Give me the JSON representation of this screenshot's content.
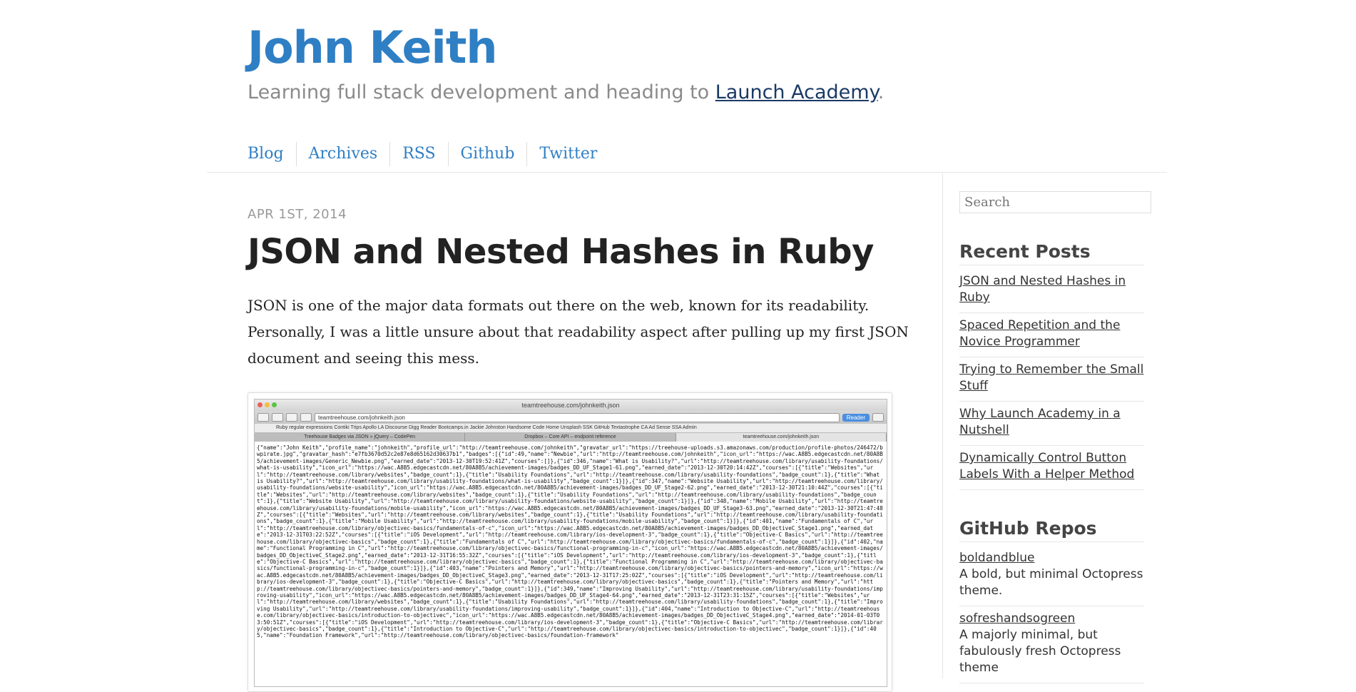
{
  "header": {
    "title": "John Keith",
    "tagline_prefix": "Learning full stack development and heading to ",
    "tagline_link": "Launch Academy",
    "tagline_suffix": "."
  },
  "nav": {
    "items": [
      "Blog",
      "Archives",
      "RSS",
      "Github",
      "Twitter"
    ]
  },
  "post": {
    "date": "APR 1ST, 2014",
    "title": "JSON and Nested Hashes in Ruby",
    "body": "JSON is one of the major data formats out there on the web, known for its readability. Personally, I was a little unsure about that readability aspect after pulling up my first JSON document and seeing this mess."
  },
  "screenshot": {
    "window_title": "teamtreehouse.com/johnkeith.json",
    "url": "teamtreehouse.com/johnkeith.json",
    "reader_label": "Reader",
    "bookmarks": "Ruby regular expressions   Contiki Trips   Apollo   LA Discourse   Digg Reader   Bootcamps.in   Jackie Johnston   Handsome Code   Home   Unsplash   SSK   GitHub   Textastrophe   CA   Ad Sense   SSA Admin",
    "tabs": [
      "Treehouse Badges via JSON » jQuery – CodePen",
      "Dropbox – Core API – endpoint reference",
      "teamtreehouse.com/johnkeith.json"
    ],
    "json_text": "{\"name\":\"John Keith\",\"profile_name\":\"johnkeith\",\"profile_url\":\"http://teamtreehouse.com/johnkeith\",\"gravatar_url\":\"https://treehouse-uploads.s3.amazonaws.com/production/profile-photos/246472/bwpirate.jpg\",\"gravatar_hash\":\"e7fb3670d52c2e87e8d65162d30637b1\",\"badges\":[{\"id\":49,\"name\":\"Newbie\",\"url\":\"http://teamtreehouse.com/johnkeith\",\"icon_url\":\"https://wac.A8B5.edgecastcdn.net/80A8B5/achievement-images/Generic_Newbie.png\",\"earned_date\":\"2013-12-30T19:52:41Z\",\"courses\":[]},{\"id\":346,\"name\":\"What is Usability?\",\"url\":\"http://teamtreehouse.com/library/usability-foundations/what-is-usability\",\"icon_url\":\"https://wac.A8B5.edgecastcdn.net/80A8B5/achievement-images/badges_DD_UF_Stage1-61.png\",\"earned_date\":\"2013-12-30T20:14:42Z\",\"courses\":[{\"title\":\"Websites\",\"url\":\"http://teamtreehouse.com/library/websites\",\"badge_count\":1},{\"title\":\"Usability Foundations\",\"url\":\"http://teamtreehouse.com/library/usability-foundations\",\"badge_count\":1},{\"title\":\"What is Usability?\",\"url\":\"http://teamtreehouse.com/library/usability-foundations/what-is-usability\",\"badge_count\":1}]},{\"id\":347,\"name\":\"Website Usability\",\"url\":\"http://teamtreehouse.com/library/usability-foundations/website-usability\",\"icon_url\":\"https://wac.A8B5.edgecastcdn.net/80A8B5/achievement-images/badges_DD_UF_Stage2-62.png\",\"earned_date\":\"2013-12-30T21:10:44Z\",\"courses\":[{\"title\":\"Websites\",\"url\":\"http://teamtreehouse.com/library/websites\",\"badge_count\":1},{\"title\":\"Usability Foundations\",\"url\":\"http://teamtreehouse.com/library/usability-foundations\",\"badge_count\":1},{\"title\":\"Website Usability\",\"url\":\"http://teamtreehouse.com/library/usability-foundations/website-usability\",\"badge_count\":1}]},{\"id\":348,\"name\":\"Mobile Usability\",\"url\":\"http://teamtreehouse.com/library/usability-foundations/mobile-usability\",\"icon_url\":\"https://wac.A8B5.edgecastcdn.net/80A8B5/achievement-images/badges_DD_UF_Stage3-63.png\",\"earned_date\":\"2013-12-30T21:47:48Z\",\"courses\":[{\"title\":\"Websites\",\"url\":\"http://teamtreehouse.com/library/websites\",\"badge_count\":1},{\"title\":\"Usability Foundations\",\"url\":\"http://teamtreehouse.com/library/usability-foundations\",\"badge_count\":1},{\"title\":\"Mobile Usability\",\"url\":\"http://teamtreehouse.com/library/usability-foundations/mobile-usability\",\"badge_count\":1}]},{\"id\":401,\"name\":\"Fundamentals of C\",\"url\":\"http://teamtreehouse.com/library/objectivec-basics/fundamentals-of-c\",\"icon_url\":\"https://wac.A8B5.edgecastcdn.net/80A8B5/achievement-images/badges_DD_ObjectiveC_Stage1.png\",\"earned_date\":\"2013-12-31T03:22:52Z\",\"courses\":[{\"title\":\"iOS Development\",\"url\":\"http://teamtreehouse.com/library/ios-development-3\",\"badge_count\":1},{\"title\":\"Objective-C Basics\",\"url\":\"http://teamtreehouse.com/library/objectivec-basics\",\"badge_count\":1},{\"title\":\"Fundamentals of C\",\"url\":\"http://teamtreehouse.com/library/objectivec-basics/fundamentals-of-c\",\"badge_count\":1}]},{\"id\":402,\"name\":\"Functional Programming in C\",\"url\":\"http://teamtreehouse.com/library/objectivec-basics/functional-programming-in-c\",\"icon_url\":\"https://wac.A8B5.edgecastcdn.net/80A8B5/achievement-images/badges_DD_ObjectiveC_Stage2.png\",\"earned_date\":\"2013-12-31T16:55:32Z\",\"courses\":[{\"title\":\"iOS Development\",\"url\":\"http://teamtreehouse.com/library/ios-development-3\",\"badge_count\":1},{\"title\":\"Objective-C Basics\",\"url\":\"http://teamtreehouse.com/library/objectivec-basics\",\"badge_count\":1},{\"title\":\"Functional Programming in C\",\"url\":\"http://teamtreehouse.com/library/objectivec-basics/functional-programming-in-c\",\"badge_count\":1}]},{\"id\":403,\"name\":\"Pointers and Memory\",\"url\":\"http://teamtreehouse.com/library/objectivec-basics/pointers-and-memory\",\"icon_url\":\"https://wac.A8B5.edgecastcdn.net/80A8B5/achievement-images/badges_DD_ObjectiveC_Stage3.png\",\"earned_date\":\"2013-12-31T17:25:02Z\",\"courses\":[{\"title\":\"iOS Development\",\"url\":\"http://teamtreehouse.com/library/ios-development-3\",\"badge_count\":1},{\"title\":\"Objective-C Basics\",\"url\":\"http://teamtreehouse.com/library/objectivec-basics\",\"badge_count\":1},{\"title\":\"Pointers and Memory\",\"url\":\"http://teamtreehouse.com/library/objectivec-basics/pointers-and-memory\",\"badge_count\":1}]},{\"id\":349,\"name\":\"Improving Usability\",\"url\":\"http://teamtreehouse.com/library/usability-foundations/improving-usability\",\"icon_url\":\"https://wac.A8B5.edgecastcdn.net/80A8B5/achievement-images/badges_DD_UF_Stage4-64.png\",\"earned_date\":\"2013-12-31T23:31:15Z\",\"courses\":[{\"title\":\"Websites\",\"url\":\"http://teamtreehouse.com/library/websites\",\"badge_count\":1},{\"title\":\"Usability Foundations\",\"url\":\"http://teamtreehouse.com/library/usability-foundations\",\"badge_count\":1},{\"title\":\"Improving Usability\",\"url\":\"http://teamtreehouse.com/library/usability-foundations/improving-usability\",\"badge_count\":1}]},{\"id\":404,\"name\":\"Introduction to Objective-C\",\"url\":\"http://teamtreehouse.com/library/objectivec-basics/introduction-to-objectivec\",\"icon_url\":\"https://wac.A8B5.edgecastcdn.net/80A8B5/achievement-images/badges_DD_ObjectiveC_Stage4.png\",\"earned_date\":\"2014-01-03T03:50:51Z\",\"courses\":[{\"title\":\"iOS Development\",\"url\":\"http://teamtreehouse.com/library/ios-development-3\",\"badge_count\":1},{\"title\":\"Objective-C Basics\",\"url\":\"http://teamtreehouse.com/library/objectivec-basics\",\"badge_count\":1},{\"title\":\"Introduction to Objective-C\",\"url\":\"http://teamtreehouse.com/library/objectivec-basics/introduction-to-objectivec\",\"badge_count\":1}]},{\"id\":405,\"name\":\"Foundation Framework\",\"url\":\"http://teamtreehouse.com/library/objectivec-basics/foundation-framework\""
  },
  "sidebar": {
    "search_placeholder": "Search",
    "recent_posts_heading": "Recent Posts",
    "recent_posts": [
      "JSON and Nested Hashes in Ruby",
      "Spaced Repetition and the Novice Programmer",
      "Trying to Remember the Small Stuff",
      "Why Launch Academy in a Nutshell",
      "Dynamically Control Button Labels With a Helper Method"
    ],
    "github_heading": "GitHub Repos",
    "repos": [
      {
        "name": "boldandblue",
        "desc": "A bold, but minimal Octopress theme."
      },
      {
        "name": "sofreshandsogreen",
        "desc": "A majorly minimal, but fabulously fresh Octopress theme"
      }
    ]
  },
  "colors": {
    "link_blue": "#2f7fc4",
    "tagline_link": "#1a3a66",
    "muted_text": "#8a8a8a"
  }
}
